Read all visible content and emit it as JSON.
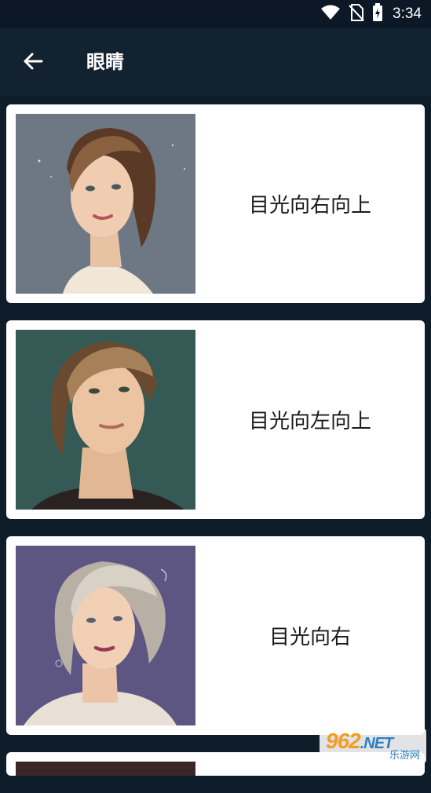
{
  "status_bar": {
    "time": "3:34",
    "icons": [
      "wifi-icon",
      "no-sim-icon",
      "battery-charging-icon"
    ]
  },
  "app_bar": {
    "back_icon": "arrow-left-icon",
    "title": "眼睛"
  },
  "items": [
    {
      "label": "目光向右向上",
      "image": "woman-portrait-looking-up-right"
    },
    {
      "label": "目光向左向上",
      "image": "woman-portrait-looking-up-left"
    },
    {
      "label": "目光向右",
      "image": "woman-portrait-looking-right"
    }
  ],
  "watermark": {
    "main": "962",
    "suffix": ".NET",
    "sub": "乐游网"
  },
  "colors": {
    "background": "#0f1d2b",
    "app_bar": "#132231",
    "card": "#ffffff",
    "image_bg_1": "#6e7885",
    "image_bg_2": "#355a55",
    "image_bg_3": "#5e5682"
  }
}
